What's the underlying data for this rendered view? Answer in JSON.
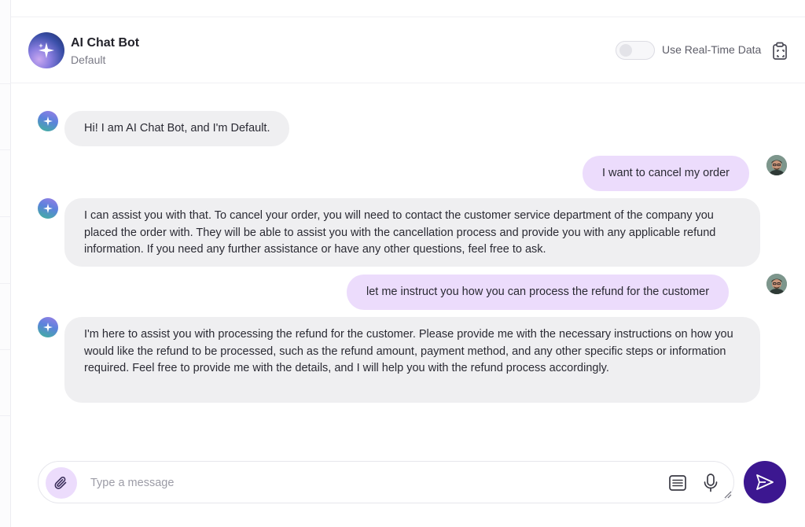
{
  "header": {
    "bot_name": "AI Chat Bot",
    "bot_mode": "Default",
    "realtime_label": "Use Real-Time Data",
    "realtime_enabled": false
  },
  "messages": [
    {
      "role": "bot",
      "text": "Hi! I am AI Chat Bot, and I'm Default."
    },
    {
      "role": "user",
      "text": "I want to cancel my order"
    },
    {
      "role": "bot",
      "text": "I can assist you with that. To cancel your order, you will need to contact the customer service department of the company you placed the order with. They will be able to assist you with the cancellation process and provide you with any applicable refund information. If you need any further assistance or have any other questions, feel free to ask."
    },
    {
      "role": "user",
      "text": "let me instruct you how you can process the refund for the customer"
    },
    {
      "role": "bot",
      "text": "I'm here to assist you with processing the refund for the customer. Please provide me with the necessary instructions on how you would like the refund to be processed, such as the refund amount, payment method, and any other specific steps or information required. Feel free to provide me with the details, and I will help you with the refund process accordingly."
    }
  ],
  "composer": {
    "placeholder": "Type a message",
    "value": ""
  },
  "icons": {
    "bot_avatar": "sparkle-icon",
    "user_avatar": "user-photo",
    "attach": "paperclip-icon",
    "copy": "clipboard-icon",
    "list": "list-icon",
    "mic": "microphone-icon",
    "send": "send-icon"
  },
  "colors": {
    "accent": "#3c1790",
    "user_bubble": "#ecdcfc",
    "bot_bubble": "#efeff1"
  }
}
